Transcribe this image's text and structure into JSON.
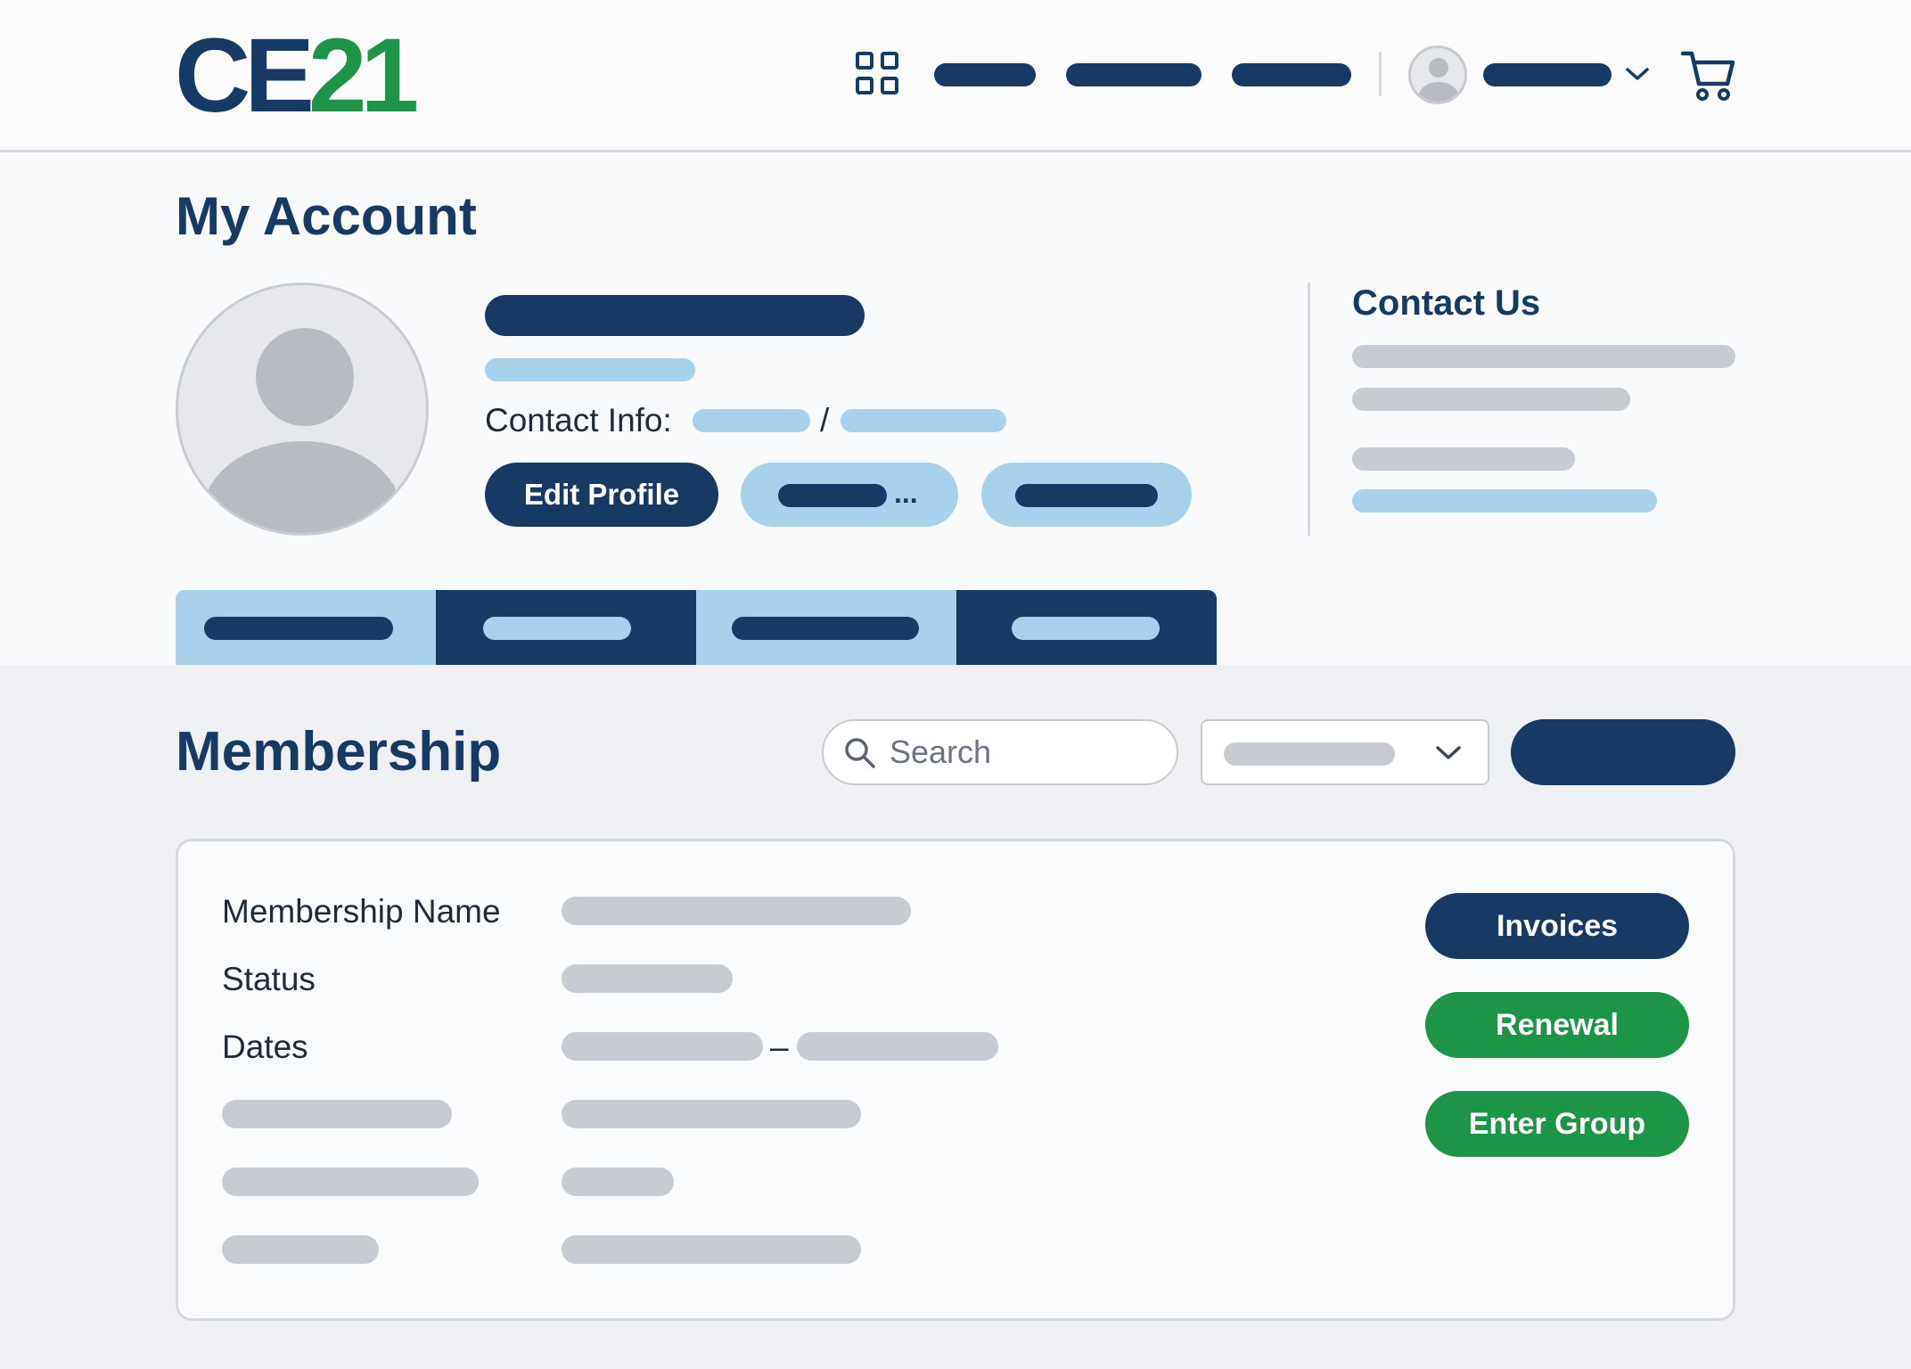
{
  "header": {
    "logo_part1": "CE",
    "logo_part2": "21",
    "icons": [
      "grid-icon",
      "user-avatar-icon",
      "chevron-down-icon",
      "cart-icon"
    ]
  },
  "account": {
    "title": "My Account",
    "contact_info_label": "Contact Info:",
    "contact_separator": "/",
    "edit_profile_label": "Edit Profile",
    "more_ellipsis": "..."
  },
  "contact_us": {
    "title": "Contact Us"
  },
  "membership": {
    "title": "Membership",
    "search_placeholder": "Search",
    "details": {
      "name_label": "Membership Name",
      "status_label": "Status",
      "dates_label": "Dates",
      "dates_separator": "–"
    },
    "actions": {
      "invoices_label": "Invoices",
      "renewal_label": "Renewal",
      "enter_group_label": "Enter Group"
    }
  },
  "colors": {
    "navy": "#173a64",
    "brand_green": "#1e9446",
    "light_blue": "#a8d2ec",
    "placeholder_gray": "#c8ccd2"
  }
}
